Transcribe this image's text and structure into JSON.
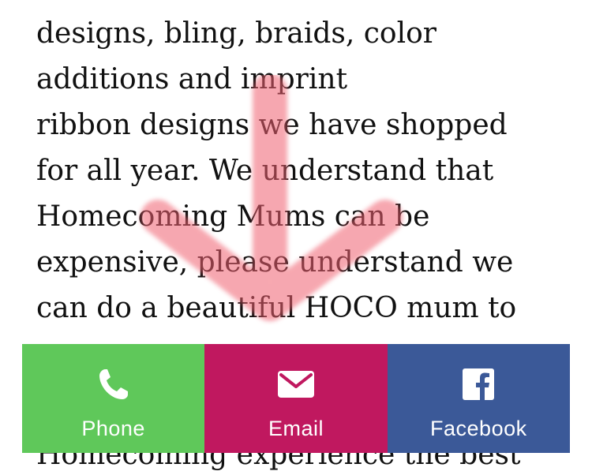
{
  "article": {
    "lines": [
      "designs, bling, braids, color",
      "additions and imprint",
      "ribbon designs we have shopped",
      "for all year.  We understand that",
      "Homecoming Mums can be",
      "expensive, please understand we",
      "can do a beautiful HOCO mum to"
    ],
    "cut_line": "Homecoming experience the best"
  },
  "overlay": {
    "icon": "down-arrow-icon",
    "color": "#f06070"
  },
  "share_bar": {
    "phone": {
      "label": "Phone",
      "icon": "phone-icon",
      "color": "#5fc85a"
    },
    "email": {
      "label": "Email",
      "icon": "envelope-icon",
      "color": "#c0185f"
    },
    "facebook": {
      "label": "Facebook",
      "icon": "facebook-icon",
      "color": "#3b5998"
    }
  }
}
